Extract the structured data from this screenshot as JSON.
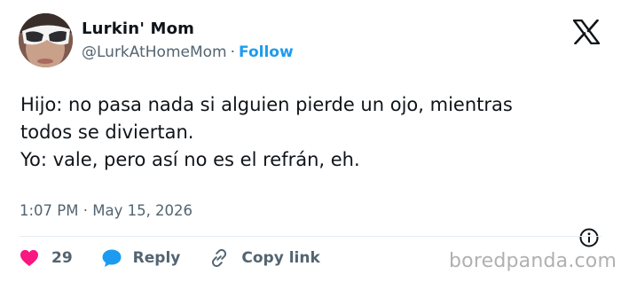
{
  "author": {
    "display_name": "Lurkin' Mom",
    "handle": "@LurkAtHomeMom",
    "separator": "·",
    "follow_label": "Follow"
  },
  "tweet": {
    "lines": [
      "Hijo: no pasa nada si alguien pierde un ojo, mientras",
      "todos se diviertan.",
      "Yo: vale, pero así no es el refrán, eh."
    ],
    "timestamp": "1:07 PM · May 15, 2026"
  },
  "actions": {
    "like_count": "29",
    "reply_label": "Reply",
    "copy_link_label": "Copy link"
  },
  "watermark": "boredpanda.com",
  "icons": {
    "brand": "x-logo-icon",
    "like": "heart-icon",
    "reply": "speech-bubble-icon",
    "copy": "link-icon",
    "info": "info-icon"
  },
  "colors": {
    "accent": "#1d9bf0",
    "text": "#0f1419",
    "muted": "#536471",
    "like": "#f91880"
  }
}
